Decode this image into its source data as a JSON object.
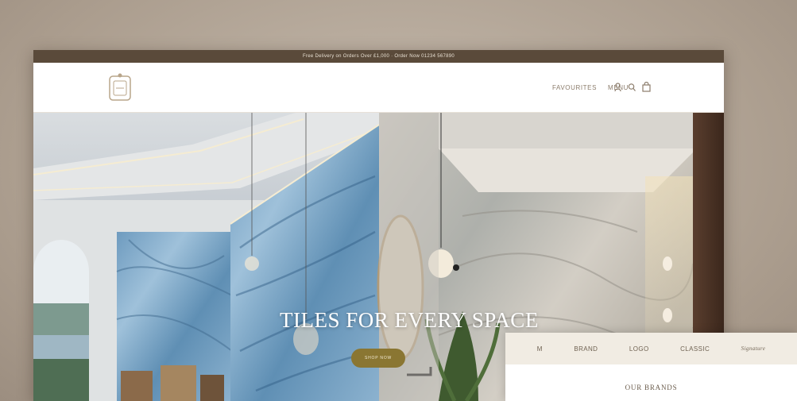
{
  "announcement": "Free Delivery on Orders Over £1,000 · Order Now 01234 567890",
  "header": {
    "nav_links": [
      "FAVOURITES",
      "MENU"
    ]
  },
  "icons": [
    "logo-crest",
    "user-icon",
    "search-icon",
    "bag-icon"
  ],
  "hero": {
    "title": "TILES FOR EVERY SPACE",
    "button_label": "SHOP NOW"
  },
  "brands": {
    "logos": [
      "M",
      "BRAND",
      "LOGO",
      "CLASSIC",
      "Signature"
    ],
    "heading": "OUR BRANDS"
  },
  "colors": {
    "announce_bar": "#5a4a3a",
    "accent_button": "#8a7632",
    "brand_strip": "#f1ece3"
  }
}
